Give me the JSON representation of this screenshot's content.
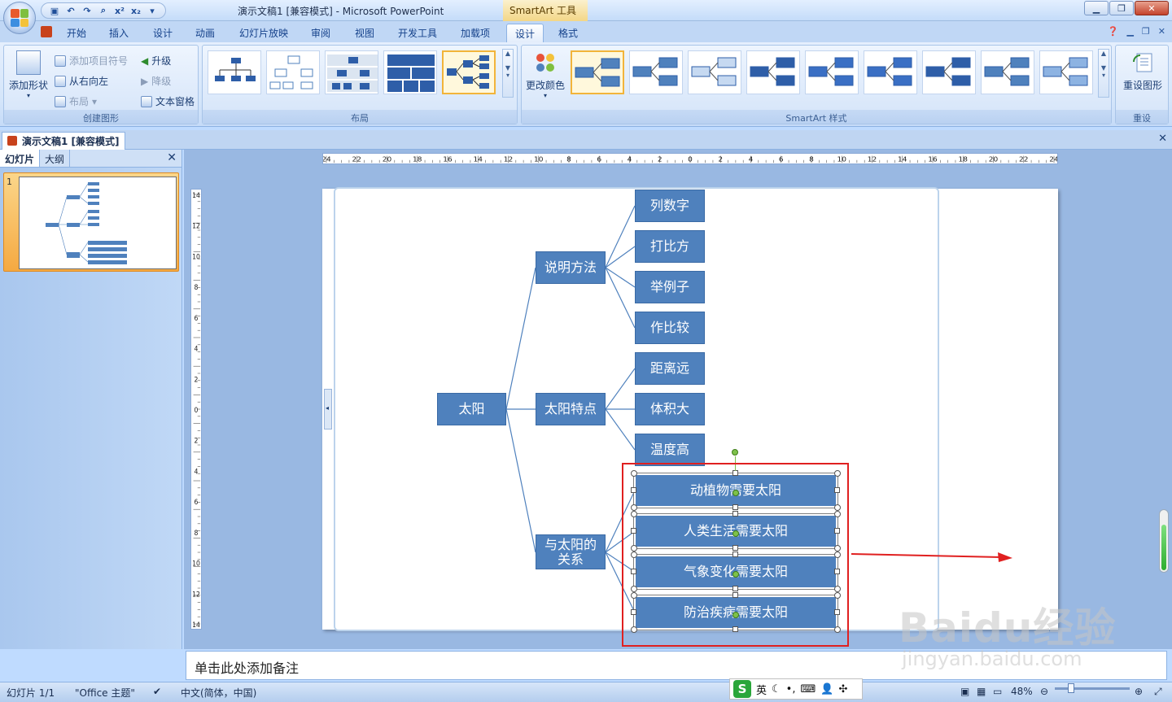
{
  "window": {
    "title": "演示文稿1 [兼容模式] - Microsoft PowerPoint",
    "contextual_tab": "SmartArt 工具"
  },
  "ribbon_tabs": [
    {
      "label": "开始"
    },
    {
      "label": "插入"
    },
    {
      "label": "设计"
    },
    {
      "label": "动画"
    },
    {
      "label": "幻灯片放映"
    },
    {
      "label": "审阅"
    },
    {
      "label": "视图"
    },
    {
      "label": "开发工具"
    },
    {
      "label": "加载项"
    },
    {
      "label": "设计"
    },
    {
      "label": "格式"
    }
  ],
  "ribbon": {
    "create_graphic": {
      "label": "创建图形",
      "add_shape": "添加形状",
      "add_bullet": "添加项目符号",
      "right_to_left": "从右向左",
      "layout": "布局",
      "promote": "升级",
      "demote": "降级",
      "text_pane": "文本窗格"
    },
    "layouts": {
      "label": "布局"
    },
    "styles": {
      "label": "SmartArt 样式",
      "change_colors": "更改颜色"
    },
    "reset": {
      "label": "重设",
      "reset_graphic": "重设图形"
    }
  },
  "document_tab": "演示文稿1 [兼容模式]",
  "left_panel": {
    "tabs": [
      "幻灯片",
      "大纲"
    ],
    "slide_number": "1"
  },
  "ruler": {
    "horizontal": [
      "24",
      "22",
      "20",
      "18",
      "16",
      "14",
      "12",
      "10",
      "8",
      "6",
      "4",
      "2",
      "0",
      "2",
      "4",
      "6",
      "8",
      "10",
      "12",
      "14",
      "16",
      "18",
      "20",
      "22",
      "24"
    ],
    "vertical": [
      "14",
      "12",
      "10",
      "8",
      "6",
      "4",
      "2",
      "0",
      "2",
      "4",
      "6",
      "8",
      "10",
      "12",
      "14"
    ]
  },
  "smartart": {
    "root": "太阳",
    "branches": [
      {
        "label": "说明方法",
        "children": [
          "列数字",
          "打比方",
          "举例子",
          "作比较"
        ]
      },
      {
        "label": "太阳特点",
        "children": [
          "距离远",
          "体积大",
          "温度高"
        ]
      },
      {
        "label": "与太阳的关系",
        "children": [
          "动植物需要太阳",
          "人类生活需要太阳",
          "气象变化需要太阳",
          "防治疾病需要太阳"
        ]
      }
    ]
  },
  "notes_placeholder": "单击此处添加备注",
  "status_bar": {
    "slide_info": "幻灯片 1/1",
    "theme": "\"Office 主题\"",
    "language": "中文(简体，中国)",
    "zoom": "48%",
    "ime_lang": "英"
  },
  "watermark": {
    "brand": "Baidu经验",
    "url": "jingyan.baidu.com"
  },
  "colors": {
    "node_fill": "#4f81bd",
    "highlight": "#e02020",
    "ribbon_bg": "#d4e5fa"
  }
}
